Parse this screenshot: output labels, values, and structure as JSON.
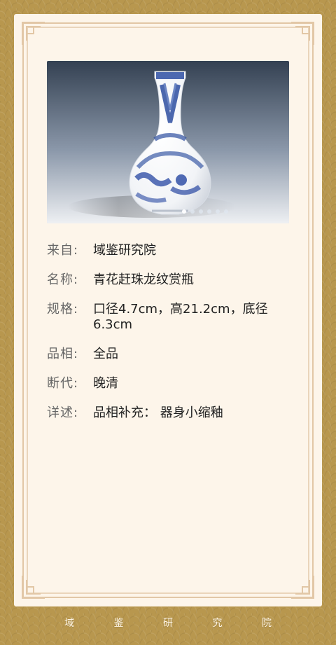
{
  "artifact": {
    "from_label": "来自:",
    "from_value": "域鉴研究院",
    "name_label": "名称:",
    "name_value": "青花赶珠龙纹赏瓶",
    "spec_label": "规格:",
    "spec_value": "口径4.7cm，高21.2cm，底径6.3cm",
    "quality_label": "品相:",
    "quality_value": "全品",
    "date_label": "断代:",
    "date_value": "晚清",
    "detail_label": "详述:",
    "detail_value": "品相补充： 器身小缩釉"
  },
  "footer": {
    "chars": [
      "域",
      "鉴",
      "研",
      "究",
      "院"
    ]
  },
  "colors": {
    "background": "#b8974e",
    "card": "#fdf5ea",
    "frame": "#e2c7a6",
    "label_text": "#666666",
    "value_text": "#222222",
    "footer_text": "#fff6e6"
  },
  "icons": {
    "corner_ornament": "fret-corner-icon",
    "carousel_dots": "carousel-dot-icon"
  }
}
